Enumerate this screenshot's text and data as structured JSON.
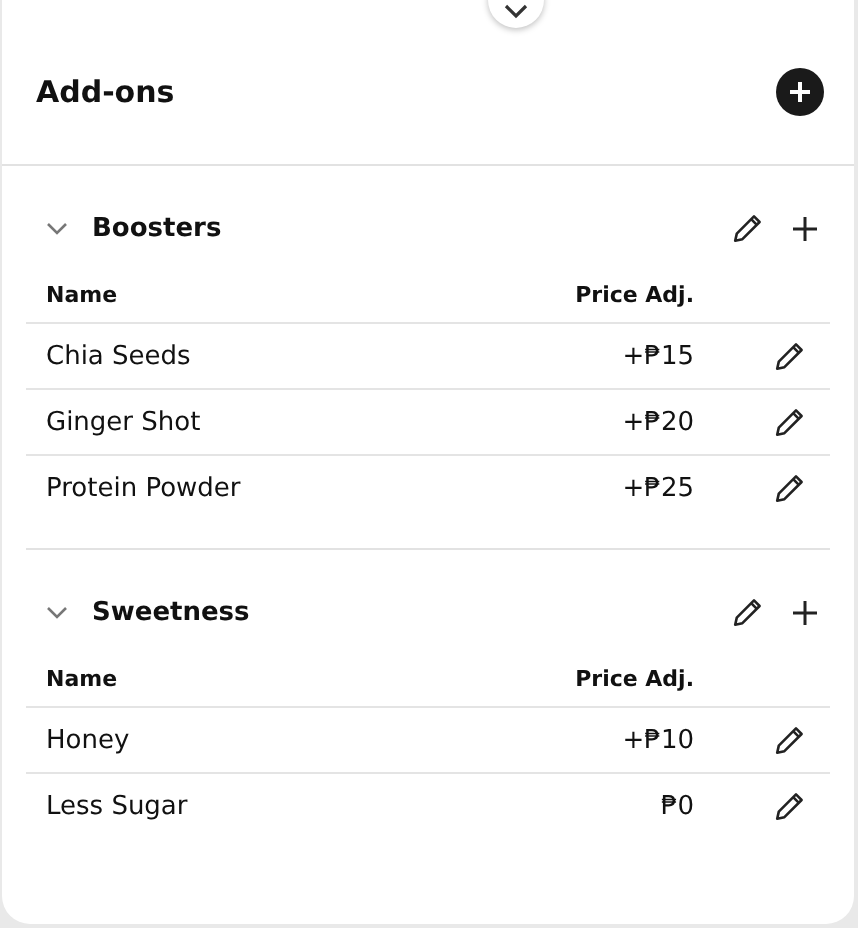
{
  "panel": {
    "title": "Add-ons"
  },
  "groups": [
    {
      "name": "Boosters",
      "expanded": true,
      "columns": [
        "Name",
        "Price Adj."
      ],
      "items": [
        {
          "name": "Chia Seeds",
          "price": "+₱15"
        },
        {
          "name": "Ginger Shot",
          "price": "+₱20"
        },
        {
          "name": "Protein Powder",
          "price": "+₱25"
        }
      ]
    },
    {
      "name": "Sweetness",
      "expanded": true,
      "columns": [
        "Name",
        "Price Adj."
      ],
      "items": [
        {
          "name": "Honey",
          "price": "+₱10"
        },
        {
          "name": "Less Sugar",
          "price": "₱0"
        }
      ]
    }
  ]
}
